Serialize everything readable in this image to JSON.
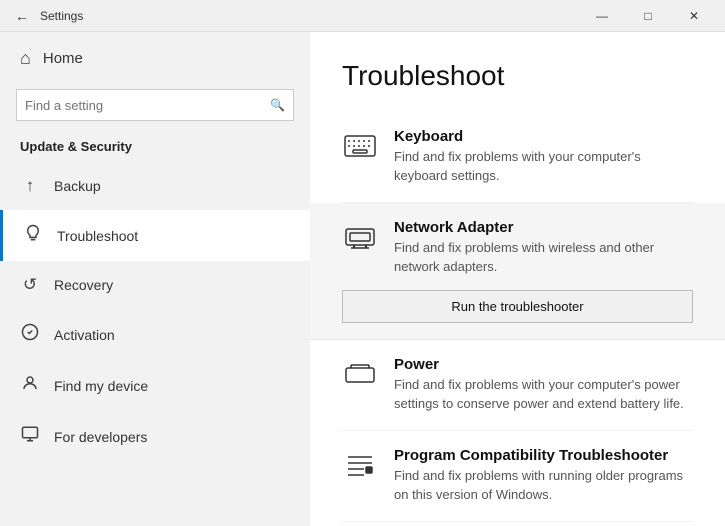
{
  "titlebar": {
    "title": "Settings",
    "back_label": "←",
    "min_label": "—",
    "max_label": "□",
    "close_label": "✕"
  },
  "sidebar": {
    "home_label": "Home",
    "search_placeholder": "Find a setting",
    "section_header": "Update & Security",
    "items": [
      {
        "id": "backup",
        "label": "Backup",
        "icon": "↑"
      },
      {
        "id": "troubleshoot",
        "label": "Troubleshoot",
        "icon": "🔑"
      },
      {
        "id": "recovery",
        "label": "Recovery",
        "icon": "↺"
      },
      {
        "id": "activation",
        "label": "Activation",
        "icon": "✓"
      },
      {
        "id": "findmydevice",
        "label": "Find my device",
        "icon": "👤"
      },
      {
        "id": "fordevelopers",
        "label": "For developers",
        "icon": "⚙"
      }
    ]
  },
  "content": {
    "title": "Troubleshoot",
    "items": [
      {
        "id": "keyboard",
        "name": "Keyboard",
        "description": "Find and fix problems with your computer's keyboard settings.",
        "highlighted": false
      },
      {
        "id": "network-adapter",
        "name": "Network Adapter",
        "description": "Find and fix problems with wireless and other network adapters.",
        "highlighted": true,
        "button_label": "Run the troubleshooter"
      },
      {
        "id": "power",
        "name": "Power",
        "description": "Find and fix problems with your computer's power settings to conserve power and extend battery life.",
        "highlighted": false
      },
      {
        "id": "program-compatibility",
        "name": "Program Compatibility Troubleshooter",
        "description": "Find and fix problems with running older programs on this version of Windows.",
        "highlighted": false
      }
    ]
  }
}
